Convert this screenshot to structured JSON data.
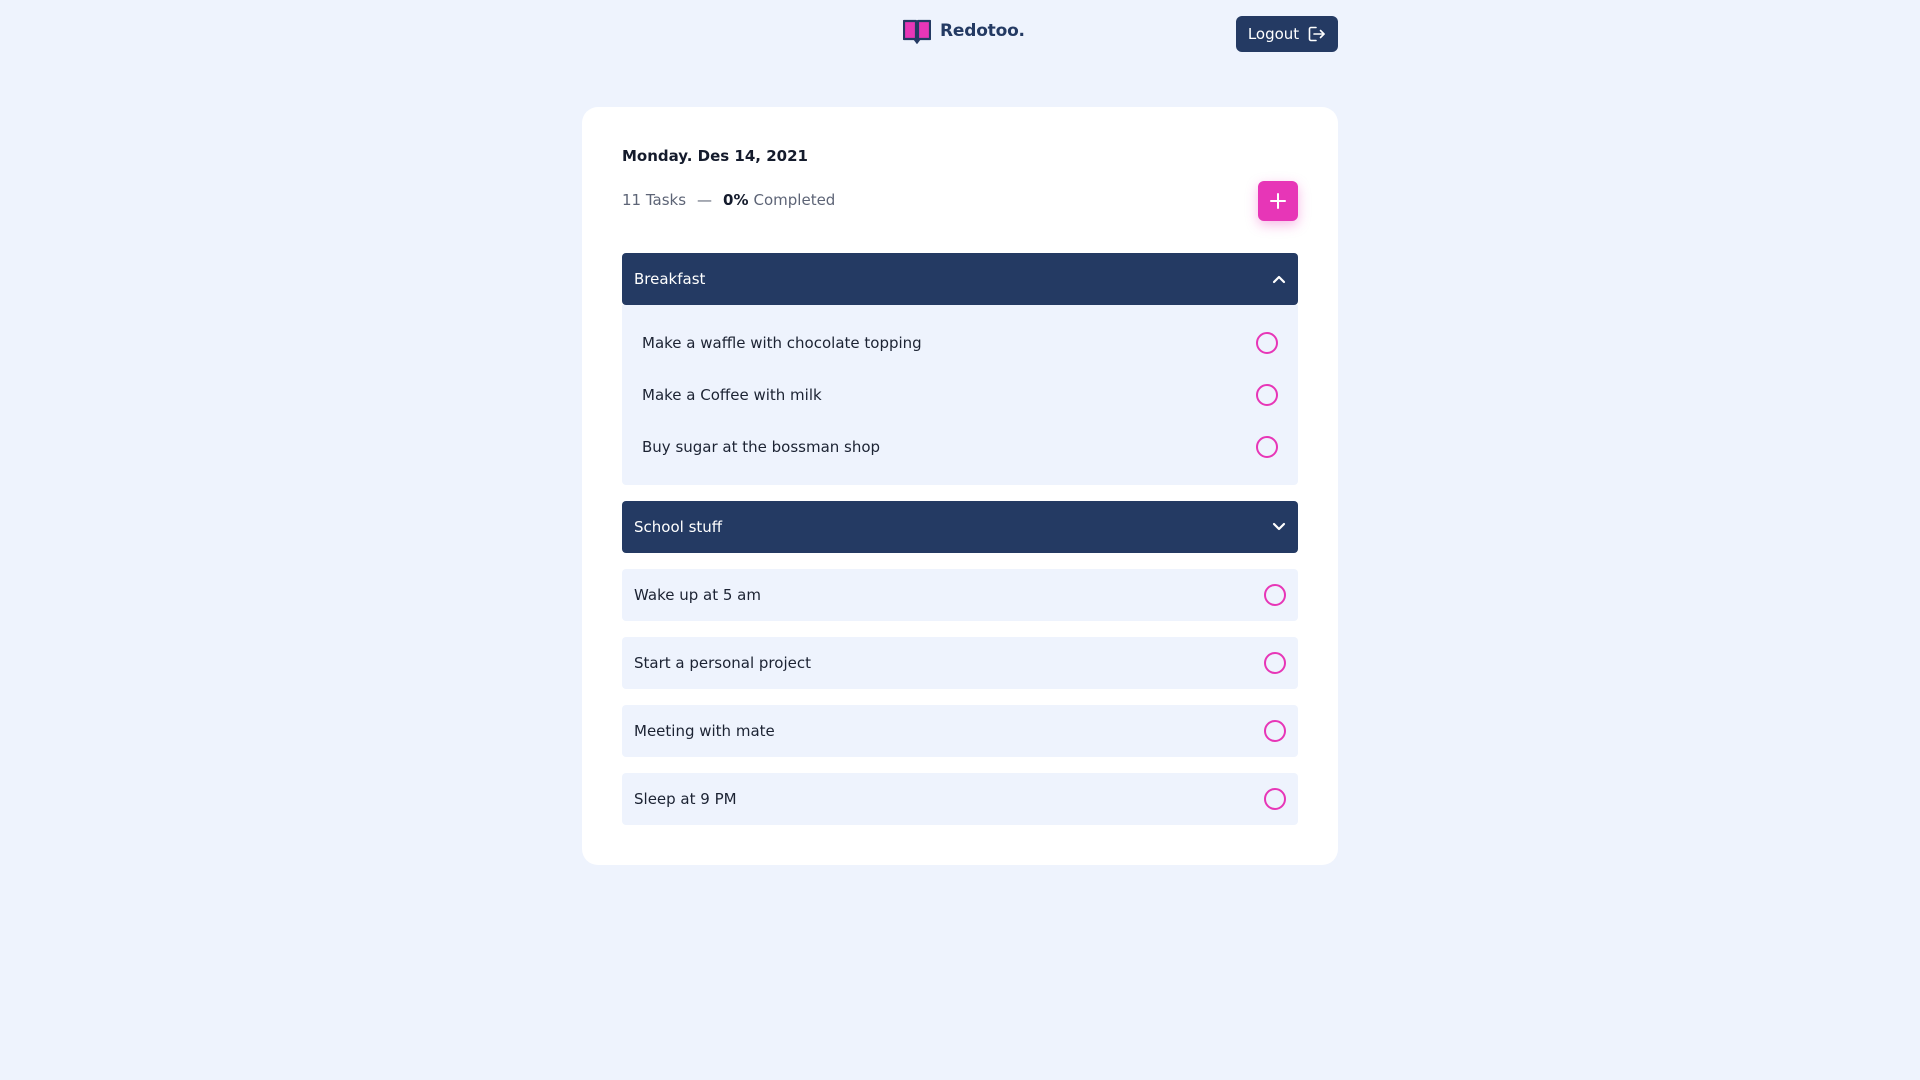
{
  "header": {
    "brand_name": "Redotoo.",
    "logout_label": "Logout"
  },
  "summary": {
    "date": "Monday. Des 14, 2021",
    "tasks_count": "11 Tasks",
    "separator": "—",
    "completed_percent": "0%",
    "completed_label": "Completed"
  },
  "groups": [
    {
      "title": "Breakfast",
      "expanded": true,
      "items": [
        {
          "label": "Make a waffle with chocolate topping",
          "done": false
        },
        {
          "label": "Make a Coffee with milk",
          "done": false
        },
        {
          "label": "Buy sugar at the bossman shop",
          "done": false
        }
      ]
    },
    {
      "title": "School stuff",
      "expanded": false
    }
  ],
  "tasks": [
    {
      "label": "Wake up at 5 am",
      "done": false
    },
    {
      "label": "Start a personal project",
      "done": false
    },
    {
      "label": "Meeting with mate",
      "done": false
    },
    {
      "label": "Sleep at 9 PM",
      "done": false
    }
  ],
  "colors": {
    "accent": "#e736b7",
    "navy": "#243a63",
    "background": "#eef3fd"
  },
  "icons": {
    "brand": "open-book-icon",
    "logout": "logout-icon",
    "add": "plus-icon",
    "collapse": "chevron-up-icon",
    "expand": "chevron-down-icon",
    "check": "circle-checkbox-icon"
  }
}
